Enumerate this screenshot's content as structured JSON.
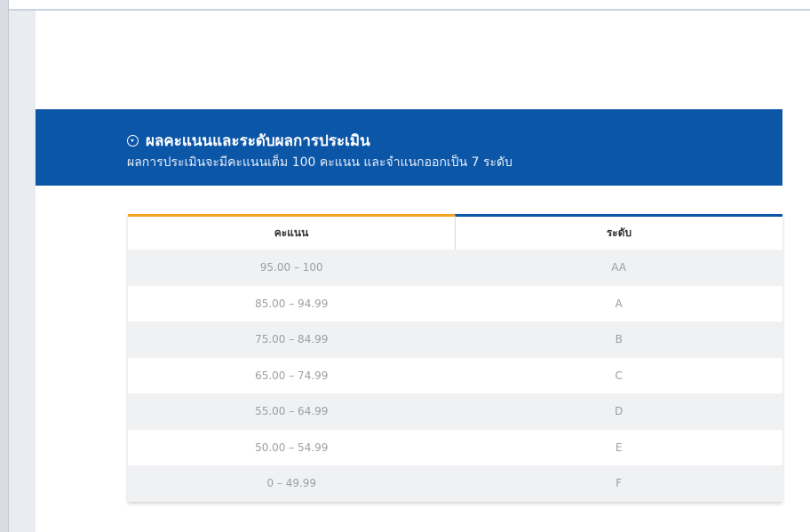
{
  "section": {
    "title": "ผลคะแนนและระดับผลการประเมิน",
    "subtitle": "ผลการประเมินจะมีคะแนนเต็ม 100 คะแนน และจำแนกออกเป็น 7 ระดับ",
    "icon": "chevron-circle-down-icon"
  },
  "table": {
    "headers": [
      "คะแนน",
      "ระดับ"
    ],
    "rows": [
      [
        "95.00 – 100",
        "AA"
      ],
      [
        "85.00 – 94.99",
        "A"
      ],
      [
        "75.00 – 84.99",
        "B"
      ],
      [
        "65.00 – 74.99",
        "C"
      ],
      [
        "55.00 – 64.99",
        "D"
      ],
      [
        "50.00 – 54.99",
        "E"
      ],
      [
        "0 – 49.99",
        "F"
      ]
    ]
  },
  "colors": {
    "banner": "#0c56a8",
    "header_accent_score": "#f2a424",
    "header_accent_grade": "#0c56a8"
  }
}
